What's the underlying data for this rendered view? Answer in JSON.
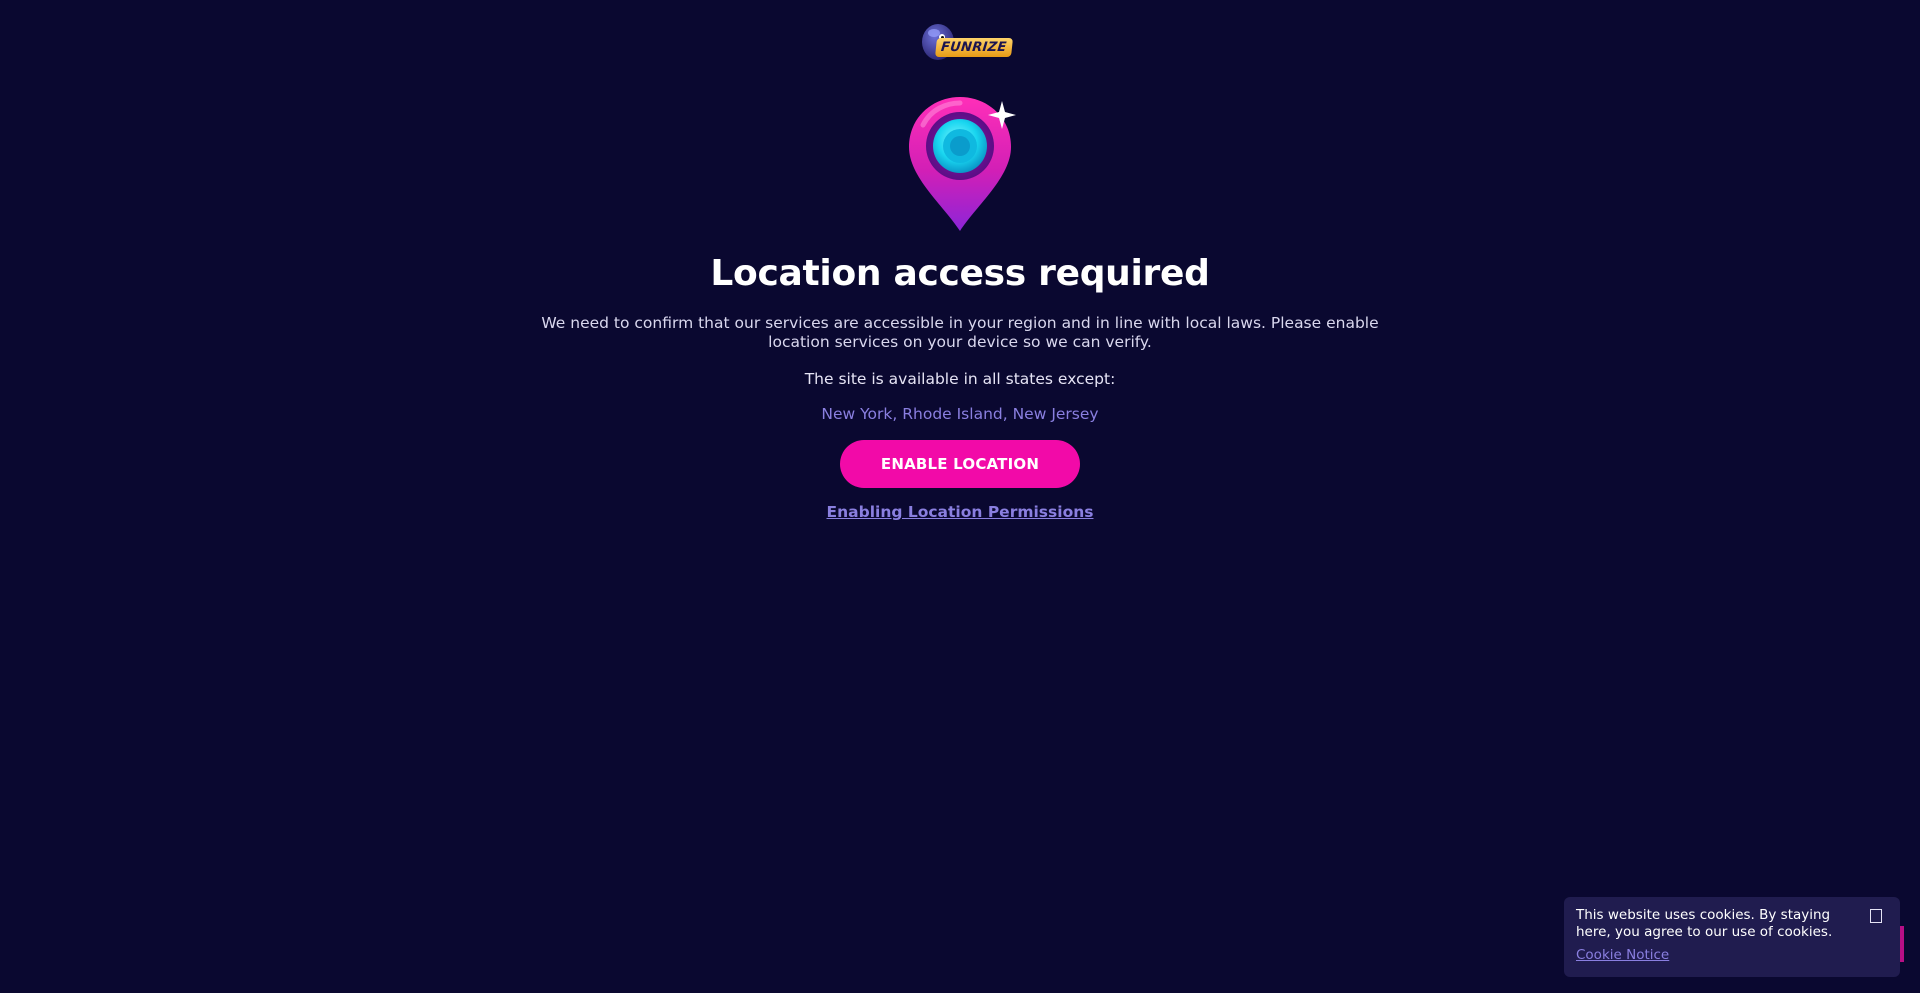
{
  "brand": {
    "logo_text": "FUNRIZE"
  },
  "main": {
    "title": "Location access required",
    "description": "We need to confirm that our services are accessible in your region and in line with local laws. Please enable location services on your device so we can verify.",
    "availability_label": "The site is available in all states except:",
    "excluded_states": "New York, Rhode Island, New Jersey",
    "enable_button_label": "ENABLE LOCATION",
    "permissions_link_label": "Enabling Location Permissions"
  },
  "cookie_banner": {
    "message": "This website uses cookies. By staying here, you agree to our use of cookies.",
    "link_label": "Cookie Notice"
  },
  "icons": {
    "location_pin": "location-pin-icon",
    "sparkle": "sparkle-icon",
    "close": "close-icon",
    "chat": "chat-icon"
  },
  "colors": {
    "background": "#0a0830",
    "accent": "#f20aa8",
    "link": "#8a7fe0",
    "cookie_bg": "#201c4f"
  }
}
